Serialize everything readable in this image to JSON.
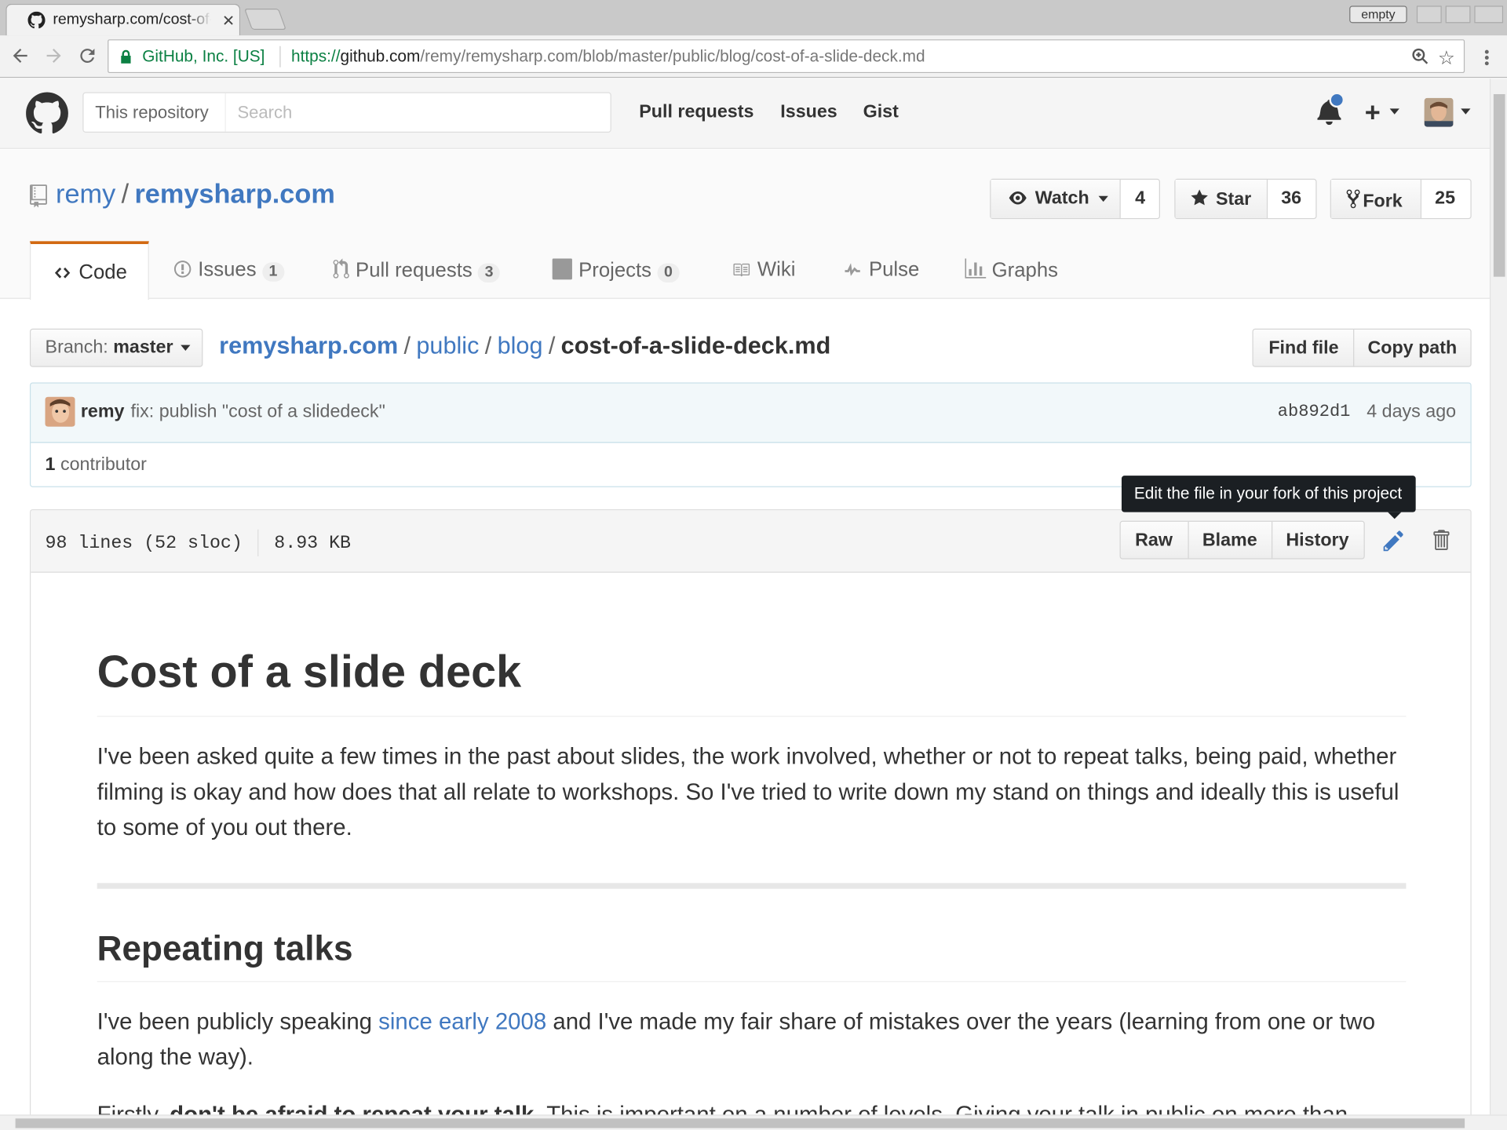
{
  "browser": {
    "tab_title": "remysharp.com/cost-of-a-slide-deck.md",
    "profile_label": "empty",
    "org_label": "GitHub, Inc. [US]",
    "url_scheme": "https://",
    "url_host": "github.com",
    "url_path": "/remy/remysharp.com/blob/master/public/blog/cost-of-a-slide-deck.md"
  },
  "header": {
    "search_scope": "This repository",
    "search_placeholder": "Search",
    "nav": [
      "Pull requests",
      "Issues",
      "Gist"
    ]
  },
  "repo": {
    "owner": "remy",
    "name": "remysharp.com",
    "watch_label": "Watch",
    "watch_count": "4",
    "star_label": "Star",
    "star_count": "36",
    "fork_label": "Fork",
    "fork_count": "25"
  },
  "tabs": [
    {
      "label": "Code"
    },
    {
      "label": "Issues",
      "count": "1"
    },
    {
      "label": "Pull requests",
      "count": "3"
    },
    {
      "label": "Projects",
      "count": "0"
    },
    {
      "label": "Wiki"
    },
    {
      "label": "Pulse"
    },
    {
      "label": "Graphs"
    }
  ],
  "file_nav": {
    "branch_prefix": "Branch:",
    "branch": "master",
    "crumbs": [
      "remysharp.com",
      "public",
      "blog"
    ],
    "filename": "cost-of-a-slide-deck.md",
    "find_file": "Find file",
    "copy_path": "Copy path"
  },
  "commit": {
    "author": "remy",
    "message": "fix: publish \"cost of a slidedeck\"",
    "sha": "ab892d1",
    "ago": "4 days ago",
    "contributors_count": "1",
    "contributors_label": "contributor"
  },
  "file": {
    "lines": "98 lines (52 sloc)",
    "size": "8.93 KB",
    "raw": "Raw",
    "blame": "Blame",
    "history": "History",
    "tooltip": "Edit the file in your fork of this project"
  },
  "markdown": {
    "h1": "Cost of a slide deck",
    "intro": "I've been asked quite a few times in the past about slides, the work involved, whether or not to repeat talks, being paid, whether filming is okay and how does that all relate to workshops. So I've tried to write down my stand on things and ideally this is useful to some of you out there.",
    "h2": "Repeating talks",
    "p2_before": "I've been publicly speaking ",
    "p2_link": "since early 2008",
    "p2_after": " and I've made my fair share of mistakes over the years (learning from one or two along the way).",
    "p3_before": "Firstly, ",
    "p3_bold": "don't be afraid to repeat your talk",
    "p3_after": ". This is important on a number of levels. Giving your talk in public on more than"
  }
}
